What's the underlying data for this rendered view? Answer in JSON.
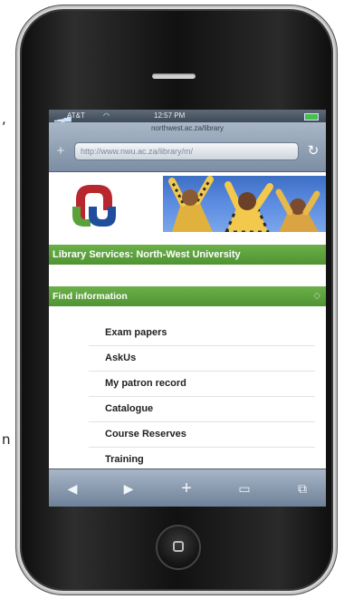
{
  "edge_fragments": {
    "comma": ",",
    "letter_n": "n"
  },
  "status_bar": {
    "carrier": "AT&T",
    "time": "12:57 PM"
  },
  "browser": {
    "page_title": "northwest.ac.za/library",
    "url": "http://www.nwu.ac.za/library/m/"
  },
  "site": {
    "title_bar": "Library Services: North-West University",
    "find_section": {
      "label": "Find information",
      "items": [
        "Exam papers",
        "AskUs",
        "My patron record",
        "Catalogue",
        "Course Reserves",
        "Training"
      ]
    }
  },
  "colors": {
    "green_bar": "#5aa03b",
    "logo_red": "#b8262e",
    "logo_green": "#5aa03b",
    "logo_blue": "#1f4f9c"
  },
  "icons": {
    "back": "left-arrow-icon",
    "forward": "right-arrow-icon",
    "add": "plus-icon",
    "bookmarks": "book-icon",
    "pages": "pages-icon",
    "reload": "reload-icon"
  }
}
